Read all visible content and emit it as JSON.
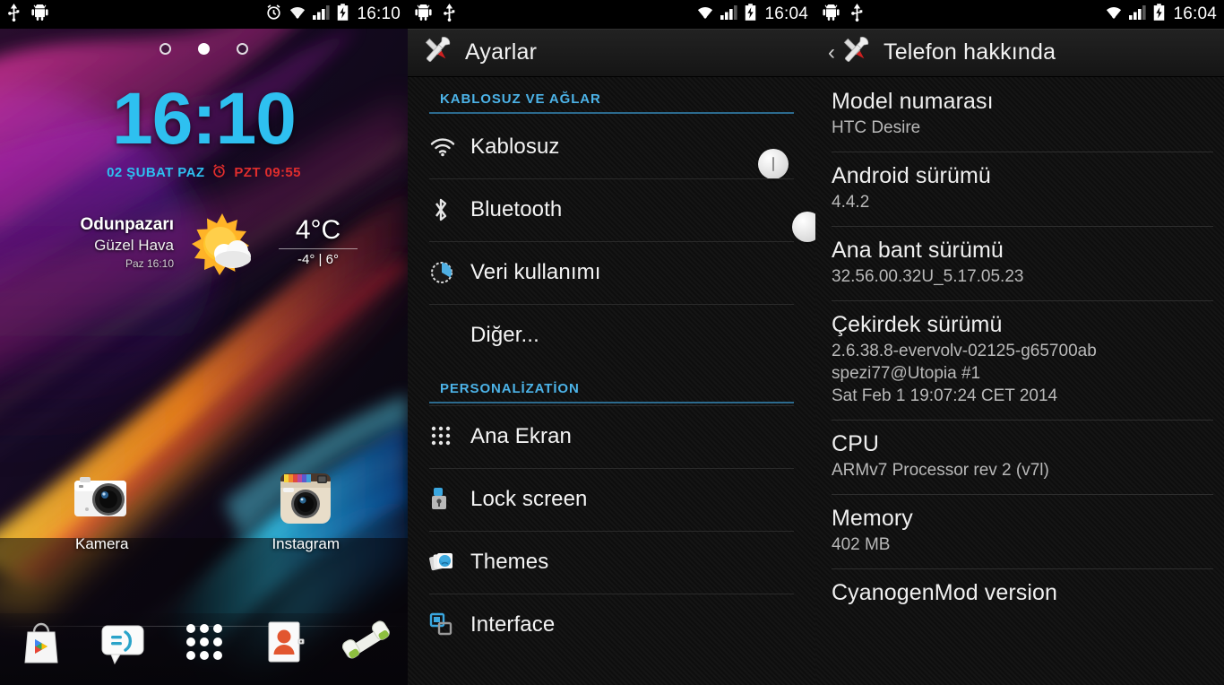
{
  "screens": {
    "home": {
      "statusbar": {
        "left_icons": [
          "usb-icon",
          "android-icon"
        ],
        "right_icons": [
          "alarm-icon",
          "wifi-icon",
          "signal-icon",
          "battery-charging-icon"
        ],
        "clock": "16:10"
      },
      "page_indicator": {
        "count": 3,
        "active_index": 1
      },
      "clock_widget": {
        "time": "16:10",
        "date": "02 ŞUBAT PAZ",
        "alarm": "PZT 09:55"
      },
      "weather_widget": {
        "city": "Odunpazarı",
        "condition": "Güzel Hava",
        "updated": "Paz 16:10",
        "temperature": "4°C",
        "low_high": "-4° | 6°",
        "icon": "sun-behind-cloud-icon"
      },
      "app_icons": [
        {
          "label": "Kamera",
          "icon": "camera-icon"
        },
        {
          "label": "Instagram",
          "icon": "instagram-icon"
        }
      ],
      "dock": [
        {
          "name": "play-store-icon"
        },
        {
          "name": "messaging-icon"
        },
        {
          "name": "app-drawer-icon"
        },
        {
          "name": "contacts-icon"
        },
        {
          "name": "phone-icon"
        }
      ]
    },
    "settings": {
      "statusbar": {
        "left_icons": [
          "android-icon",
          "usb-icon"
        ],
        "right_icons": [
          "wifi-icon",
          "signal-icon",
          "battery-charging-icon"
        ],
        "clock": "16:04"
      },
      "actionbar": {
        "title": "Ayarlar",
        "icon": "settings-tools-icon"
      },
      "sections": [
        {
          "header": "KABLOSUZ VE AĞLAR",
          "rows": [
            {
              "label": "Kablosuz",
              "icon": "wifi-icon",
              "control": "toggle",
              "state": "on"
            },
            {
              "label": "Bluetooth",
              "icon": "bluetooth-icon",
              "control": "toggle",
              "state": "off"
            },
            {
              "label": "Veri kullanımı",
              "icon": "data-usage-icon",
              "control": "none"
            },
            {
              "label": "Diğer...",
              "icon": "none",
              "control": "none"
            }
          ]
        },
        {
          "header": "PERSONALİZATİON",
          "rows": [
            {
              "label": "Ana Ekran",
              "icon": "grid-dots-icon",
              "control": "none"
            },
            {
              "label": "Lock screen",
              "icon": "lock-icon",
              "control": "none"
            },
            {
              "label": "Themes",
              "icon": "themes-icon",
              "control": "none"
            },
            {
              "label": "Interface",
              "icon": "interface-windows-icon",
              "control": "none"
            }
          ]
        }
      ]
    },
    "about": {
      "statusbar": {
        "left_icons": [
          "android-icon",
          "usb-icon"
        ],
        "right_icons": [
          "wifi-icon",
          "signal-icon",
          "battery-charging-icon"
        ],
        "clock": "16:04"
      },
      "actionbar": {
        "back": "‹",
        "title": "Telefon hakkında",
        "icon": "settings-tools-icon"
      },
      "items": [
        {
          "title": "Model numarası",
          "value": "HTC Desire"
        },
        {
          "title": "Android sürümü",
          "value": "4.4.2"
        },
        {
          "title": "Ana bant sürümü",
          "value": "32.56.00.32U_5.17.05.23"
        },
        {
          "title": "Çekirdek sürümü",
          "value": "2.6.38.8-evervolv-02125-g65700ab\nspezi77@Utopia #1\nSat Feb 1 19:07:24 CET 2014"
        },
        {
          "title": "CPU",
          "value": "ARMv7 Processor rev 2 (v7l)"
        },
        {
          "title": "Memory",
          "value": "402 MB"
        },
        {
          "title": "CyanogenMod version",
          "value": ""
        }
      ]
    }
  },
  "colors": {
    "accent_blue": "#4cb3e8",
    "clock_blue": "#2ec0f0",
    "alarm_red": "#e02d2d",
    "toggle_on": "#4fb0e4",
    "toggle_off": "#4d4d4d",
    "list_bg": "#101010",
    "text_primary": "#f2f2f2",
    "text_secondary": "#b9b9b9"
  }
}
